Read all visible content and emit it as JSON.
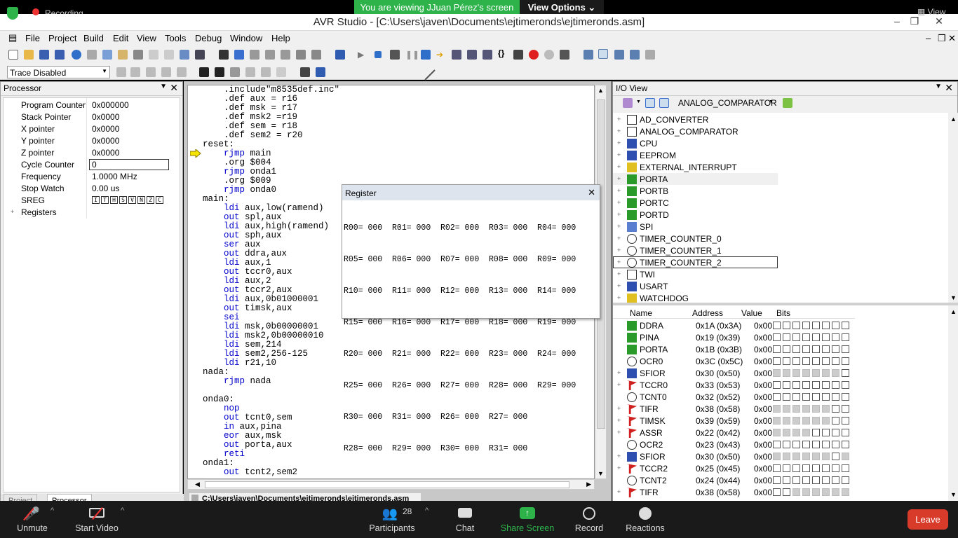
{
  "zoom": {
    "recording": "Recording",
    "viewing": "You are viewing JJuan Pérez's screen",
    "view_options": "View Options",
    "view_right": "View",
    "unmute": "Unmute",
    "start_video": "Start Video",
    "participants": "Participants",
    "participant_count": "28",
    "chat": "Chat",
    "share_screen": "Share Screen",
    "record": "Record",
    "reactions": "Reactions",
    "leave": "Leave"
  },
  "app": {
    "title": "AVR Studio - [C:\\Users\\javen\\Documents\\ejtimeronds\\ejtimeronds.asm]"
  },
  "menu": [
    "File",
    "Project",
    "Build",
    "Edit",
    "View",
    "Tools",
    "Debug",
    "Window",
    "Help"
  ],
  "toolbar": {
    "trace": "Trace Disabled"
  },
  "processor": {
    "title": "Processor",
    "rows": [
      {
        "n": "Program Counter",
        "v": "0x000000"
      },
      {
        "n": "Stack Pointer",
        "v": "0x0000"
      },
      {
        "n": "X pointer",
        "v": "0x0000"
      },
      {
        "n": "Y pointer",
        "v": "0x0000"
      },
      {
        "n": "Z pointer",
        "v": "0x0000"
      },
      {
        "n": "Cycle Counter",
        "v": "0"
      },
      {
        "n": "Frequency",
        "v": "1.0000 MHz"
      },
      {
        "n": "Stop Watch",
        "v": "0.00 us"
      },
      {
        "n": "SREG",
        "v": ""
      },
      {
        "n": "Registers",
        "v": ""
      }
    ],
    "sreg_bits": [
      "I",
      "T",
      "H",
      "S",
      "V",
      "N",
      "Z",
      "C"
    ],
    "tabs": [
      "Project",
      "Processor"
    ]
  },
  "editor": {
    "path": "C:\\Users\\javen\\Documents\\ejtimeronds\\ejtimeronds.asm",
    "lines": [
      "    .include\"m8535def.inc\"",
      "    .def aux = r16",
      "    .def msk = r17",
      "    .def msk2 =r19",
      "    .def sem = r18",
      "    .def sem2 = r20",
      "reset:",
      "    rjmp main",
      "    .org $004",
      "    rjmp onda1",
      "    .org $009",
      "    rjmp onda0",
      "main:",
      "    ldi aux,low(ramend)",
      "    out spl,aux",
      "    ldi aux,high(ramend)",
      "    out sph,aux",
      "    ser aux",
      "    out ddra,aux",
      "    ldi aux,1",
      "    out tccr0,aux",
      "    ldi aux,2",
      "    out tccr2,aux",
      "    ldi aux,0b01000001",
      "    out timsk,aux",
      "    sei",
      "    ldi msk,0b00000001",
      "    ldi msk2,0b00000010",
      "    ldi sem,214",
      "    ldi sem2,256-125",
      "    ldi r21,10",
      "nada:",
      "    rjmp nada",
      "",
      "onda0:",
      "    nop",
      "    out tcnt0,sem",
      "    in aux,pina",
      "    eor aux,msk",
      "    out porta,aux",
      "    reti",
      "onda1:",
      "    out tcnt2,sem2"
    ]
  },
  "register": {
    "title": "Register",
    "lines": [
      "R00= 000  R01= 000  R02= 000  R03= 000  R04= 000",
      "R05= 000  R06= 000  R07= 000  R08= 000  R09= 000",
      "R10= 000  R11= 000  R12= 000  R13= 000  R14= 000",
      "R15= 000  R16= 000  R17= 000  R18= 000  R19= 000",
      "R20= 000  R21= 000  R22= 000  R23= 000  R24= 000",
      "R25= 000  R26= 000  R27= 000  R28= 000  R29= 000",
      "R30= 000  R31= 000  R26= 000  R27= 000",
      "R28= 000  R29= 000  R30= 000  R31= 000"
    ]
  },
  "io": {
    "title": "I/O View",
    "selected": "ANALOG_COMPARATOR",
    "tree": [
      "AD_CONVERTER",
      "ANALOG_COMPARATOR",
      "CPU",
      "EEPROM",
      "EXTERNAL_INTERRUPT",
      "PORTA",
      "PORTB",
      "PORTC",
      "PORTD",
      "SPI",
      "TIMER_COUNTER_0",
      "TIMER_COUNTER_1",
      "TIMER_COUNTER_2",
      "TWI",
      "USART",
      "WATCHDOG"
    ],
    "headers": {
      "name": "Name",
      "address": "Address",
      "value": "Value",
      "bits": "Bits"
    },
    "regs": [
      {
        "n": "DDRA",
        "a": "0x1A (0x3A)",
        "v": "0x00",
        "bits": "wwwwwwww",
        "plus": false
      },
      {
        "n": "PINA",
        "a": "0x19 (0x39)",
        "v": "0x00",
        "bits": "wwwwwwww",
        "plus": false
      },
      {
        "n": "PORTA",
        "a": "0x1B (0x3B)",
        "v": "0x00",
        "bits": "wwwwwwww",
        "plus": false
      },
      {
        "n": "OCR0",
        "a": "0x3C (0x5C)",
        "v": "0x00",
        "bits": "wwwwwwww",
        "plus": false
      },
      {
        "n": "SFIOR",
        "a": "0x30 (0x50)",
        "v": "0x00",
        "bits": "gggggggw",
        "plus": true
      },
      {
        "n": "TCCR0",
        "a": "0x33 (0x53)",
        "v": "0x00",
        "bits": "wwwwwwww",
        "plus": true
      },
      {
        "n": "TCNT0",
        "a": "0x32 (0x52)",
        "v": "0x00",
        "bits": "wwwwwwww",
        "plus": false
      },
      {
        "n": "TIFR",
        "a": "0x38 (0x58)",
        "v": "0x00",
        "bits": "ggggggww",
        "plus": true
      },
      {
        "n": "TIMSK",
        "a": "0x39 (0x59)",
        "v": "0x00",
        "bits": "ggggggww",
        "plus": true
      },
      {
        "n": "ASSR",
        "a": "0x22 (0x42)",
        "v": "0x00",
        "bits": "ggggwwww",
        "plus": true
      },
      {
        "n": "OCR2",
        "a": "0x23 (0x43)",
        "v": "0x00",
        "bits": "wwwwwwww",
        "plus": false
      },
      {
        "n": "SFIOR",
        "a": "0x30 (0x50)",
        "v": "0x00",
        "bits": "ggggggwg",
        "plus": true
      },
      {
        "n": "TCCR2",
        "a": "0x25 (0x45)",
        "v": "0x00",
        "bits": "wwwwwwww",
        "plus": true
      },
      {
        "n": "TCNT2",
        "a": "0x24 (0x44)",
        "v": "0x00",
        "bits": "wwwwwwww",
        "plus": false
      },
      {
        "n": "TIFR",
        "a": "0x38 (0x58)",
        "v": "0x00",
        "bits": "wwgggggg",
        "plus": true
      }
    ]
  }
}
